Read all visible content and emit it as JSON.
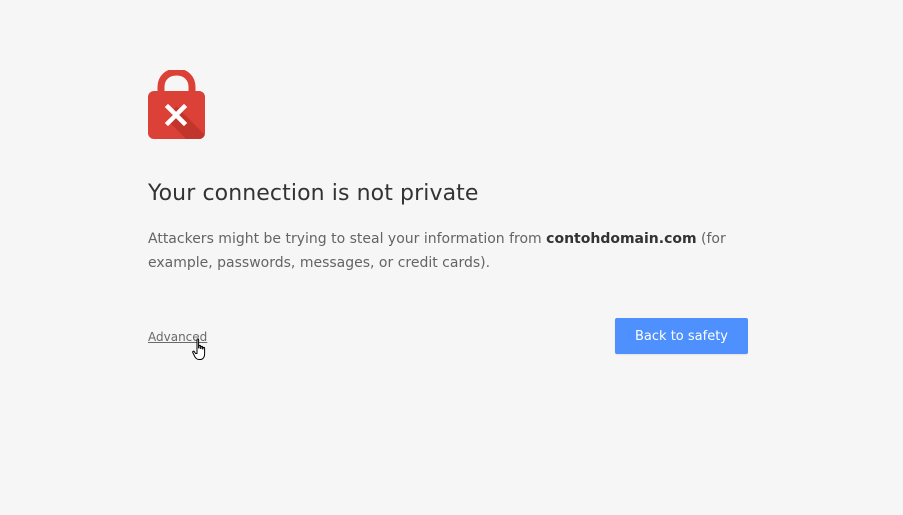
{
  "interstitial": {
    "lock_icon": "lock-x-icon",
    "title": "Your connection is not private",
    "message_prefix": "Attackers might be trying to steal your information from ",
    "domain": "contohdomain.com",
    "message_suffix": " (for example, passwords, messages, or credit cards).",
    "advanced_label": "Advanced",
    "back_button_label": "Back to safety"
  },
  "colors": {
    "background": "#f6f6f6",
    "lock_red": "#dc4137",
    "button_blue": "#4d90fe"
  }
}
